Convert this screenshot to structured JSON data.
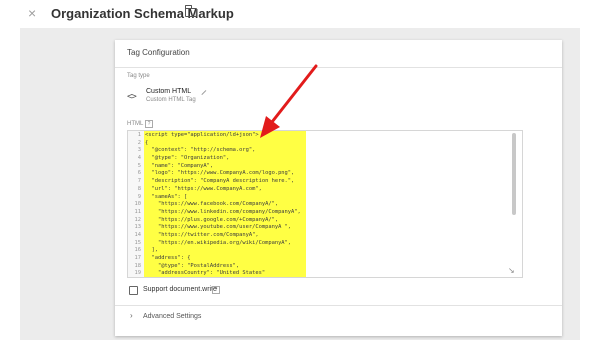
{
  "header": {
    "close_icon": "×",
    "title": "Organization Schema Markup",
    "folder_icon": "folder-icon"
  },
  "card": {
    "title": "Tag Configuration",
    "tag_type_label": "Tag type",
    "tag_icon": "<>",
    "tag_name": "Custom HTML",
    "tag_subtitle": "Custom HTML Tag",
    "html_label": "HTML",
    "help_icon": "?",
    "code_lines": [
      {
        "n": "1",
        "text": "<script type=\"application/ld+json\">"
      },
      {
        "n": "2",
        "text": "{"
      },
      {
        "n": "3",
        "text": "  \"@context\": \"http://schema.org\","
      },
      {
        "n": "4",
        "text": "  \"@type\": \"Organization\","
      },
      {
        "n": "5",
        "text": "  \"name\": \"CompanyA\","
      },
      {
        "n": "6",
        "text": "  \"logo\": \"https://www.CompanyA.com/logo.png\","
      },
      {
        "n": "7",
        "text": "  \"description\": \"CompanyA description here.\","
      },
      {
        "n": "8",
        "text": "  \"url\": \"https://www.CompanyA.com\","
      },
      {
        "n": "9",
        "text": "  \"sameAs\": ["
      },
      {
        "n": "10",
        "text": "    \"https://www.facebook.com/CompanyA/\","
      },
      {
        "n": "11",
        "text": "    \"https://www.linkedin.com/company/CompanyA\","
      },
      {
        "n": "12",
        "text": "    \"https://plus.google.com/+CompanyA/\","
      },
      {
        "n": "13",
        "text": "    \"https://www.youtube.com/user/CompanyA \","
      },
      {
        "n": "14",
        "text": "    \"https://twitter.com/CompanyA\","
      },
      {
        "n": "15",
        "text": "    \"https://en.wikipedia.org/wiki/CompanyA\","
      },
      {
        "n": "16",
        "text": "  ],"
      },
      {
        "n": "17",
        "text": "  \"address\": {"
      },
      {
        "n": "18",
        "text": "    \"@type\": \"PostalAddress\","
      },
      {
        "n": "19",
        "text": "    \"addressCountry\": \"United States\""
      }
    ],
    "resize_icon": "↘",
    "support_label": "Support document.write",
    "advanced_chevron": "›",
    "advanced_label": "Advanced Settings"
  },
  "colors": {
    "highlight": "#ffff44",
    "arrow": "#e21b1b",
    "background": "#ececec"
  }
}
